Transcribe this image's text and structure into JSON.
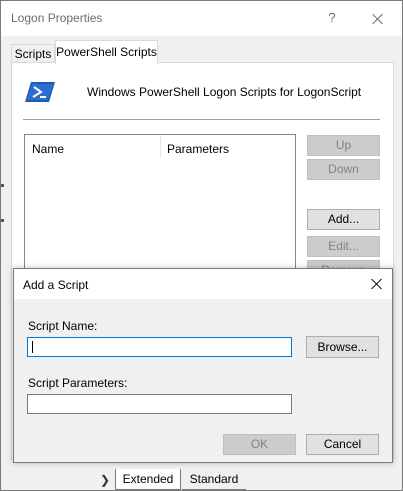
{
  "window": {
    "title": "Logon Properties",
    "help_glyph": "?"
  },
  "tabs": [
    {
      "label": "Scripts"
    },
    {
      "label": "PowerShell Scripts"
    }
  ],
  "panel": {
    "description": "Windows PowerShell Logon Scripts for LogonScript",
    "columns": {
      "name": "Name",
      "parameters": "Parameters"
    },
    "buttons": {
      "up": "Up",
      "down": "Down",
      "add": "Add...",
      "edit": "Edit...",
      "remove": "Remove"
    }
  },
  "bottom_tabs": [
    {
      "label": "Extended"
    },
    {
      "label": "Standard"
    }
  ],
  "dialog": {
    "title": "Add a Script",
    "script_name_label": "Script Name:",
    "script_name_value": "",
    "browse_label": "Browse...",
    "script_params_label": "Script Parameters:",
    "script_params_value": "",
    "ok_label": "OK",
    "cancel_label": "Cancel"
  },
  "colors": {
    "accent": "#0078d7",
    "ps_icon": "#1e5bb5",
    "disabled_text": "#838383"
  },
  "icons": {
    "help": "help-icon",
    "close": "close-icon",
    "powershell": "powershell-icon",
    "nav_right": "chevron-right-icon"
  }
}
